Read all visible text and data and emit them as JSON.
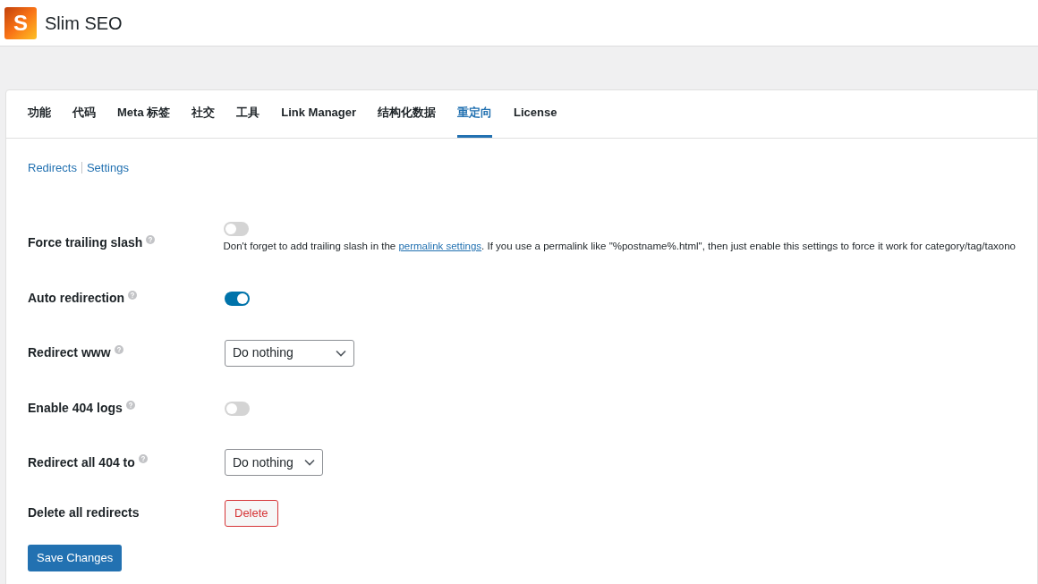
{
  "header": {
    "logo_letter": "S",
    "title": "Slim SEO"
  },
  "tabs": [
    {
      "label": "功能",
      "selected": false
    },
    {
      "label": "代码",
      "selected": false
    },
    {
      "label": "Meta 标签",
      "selected": false
    },
    {
      "label": "社交",
      "selected": false
    },
    {
      "label": "工具",
      "selected": false
    },
    {
      "label": "Link Manager",
      "selected": false
    },
    {
      "label": "结构化数据",
      "selected": false
    },
    {
      "label": "重定向",
      "selected": true
    },
    {
      "label": "License",
      "selected": false
    }
  ],
  "subnav": [
    {
      "label": "Redirects"
    },
    {
      "label": "Settings"
    }
  ],
  "settings": [
    {
      "kind": "toggle",
      "label": "Force trailing slash",
      "help": true,
      "on": false,
      "description": {
        "before": "Don't forget to add trailing slash in the ",
        "link": "permalink settings",
        "after": ". If you use a permalink like \"%postname%.html\", then just enable this settings to force it work for category/tag/taxono"
      }
    },
    {
      "kind": "toggle",
      "label": "Auto redirection",
      "help": true,
      "on": true
    },
    {
      "kind": "select",
      "label": "Redirect www",
      "help": true,
      "value": "Do nothing"
    },
    {
      "kind": "toggle",
      "label": "Enable 404 logs",
      "help": true,
      "on": false
    },
    {
      "kind": "select",
      "label": "Redirect all 404 to",
      "help": true,
      "value": "Do nothing"
    },
    {
      "kind": "button",
      "label": "Delete all redirects",
      "help": false,
      "button": "Delete"
    }
  ],
  "save_button": "Save Changes"
}
